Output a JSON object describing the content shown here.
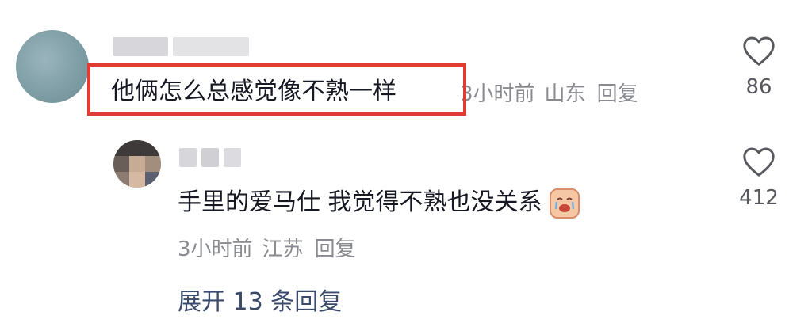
{
  "main_comment": {
    "text": "他俩怎么总感觉像不熟一样",
    "time": "3小时前",
    "region": "山东",
    "reply_label": "回复",
    "likes": "86"
  },
  "reply_comment": {
    "text": "手里的爱马仕 我觉得不熟也没关系",
    "time": "3小时前",
    "region": "江苏",
    "reply_label": "回复",
    "likes": "412"
  },
  "expand_replies": "展开 13 条回复",
  "icons": {
    "like": "heart-outline-icon",
    "emoji": "crying-face-emoji"
  },
  "colors": {
    "highlight": "#e03c34",
    "meta": "#8a8b91",
    "link": "#3a4a6b"
  }
}
